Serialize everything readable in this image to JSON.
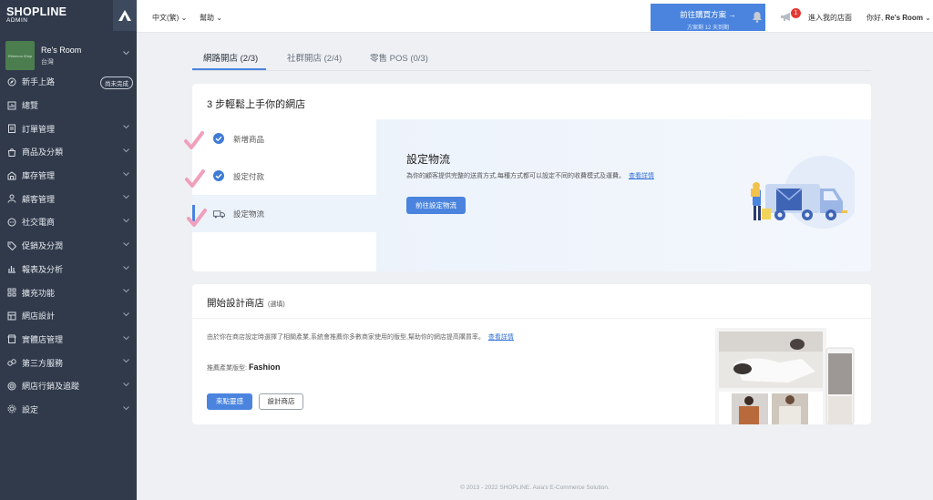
{
  "brand": {
    "logo": "SHOPLINE",
    "sub": "ADMIN"
  },
  "store": {
    "name": "Re's Room",
    "region": "台灣",
    "thumb_text": "Rebecca Shop"
  },
  "nav": {
    "items": [
      {
        "label": "新手上路",
        "icon": "compass-icon",
        "badge": "尚未完成"
      },
      {
        "label": "總覽",
        "icon": "dashboard-icon"
      },
      {
        "label": "訂單管理",
        "icon": "clipboard-icon",
        "chevron": true
      },
      {
        "label": "商品及分類",
        "icon": "bag-icon",
        "chevron": true
      },
      {
        "label": "庫存管理",
        "icon": "warehouse-icon",
        "chevron": true
      },
      {
        "label": "顧客管理",
        "icon": "person-icon",
        "chevron": true
      },
      {
        "label": "社交電商",
        "icon": "chat-icon",
        "chevron": true
      },
      {
        "label": "促銷及分潤",
        "icon": "tag-icon",
        "chevron": true
      },
      {
        "label": "報表及分析",
        "icon": "chart-icon",
        "chevron": true
      },
      {
        "label": "擴充功能",
        "icon": "grid-icon",
        "chevron": true
      },
      {
        "label": "網店設計",
        "icon": "design-icon",
        "chevron": true
      },
      {
        "label": "實體店管理",
        "icon": "store-icon",
        "chevron": true
      },
      {
        "label": "第三方服務",
        "icon": "link-icon",
        "chevron": true
      },
      {
        "label": "網店行銷及追蹤",
        "icon": "target-icon",
        "chevron": true
      },
      {
        "label": "設定",
        "icon": "gear-icon",
        "chevron": true
      }
    ]
  },
  "topbar": {
    "language": "中文(繁)",
    "help": "幫助",
    "buy_title": "前往購買方案 →",
    "buy_sub": "方案剩 12 天到期",
    "notification_count": "1",
    "enter_store": "進入我的店面",
    "greeting": "你好,",
    "user": "Re's Room"
  },
  "tabs": [
    {
      "label": "網路開店 (2/3)",
      "active": true
    },
    {
      "label": "社群開店 (2/4)",
      "active": false
    },
    {
      "label": "零售 POS (0/3)",
      "active": false
    }
  ],
  "setup": {
    "title": "3 步輕鬆上手你的網店",
    "steps": [
      {
        "label": "新增商品",
        "done": true
      },
      {
        "label": "設定付款",
        "done": true
      },
      {
        "label": "設定物流",
        "done": false
      }
    ],
    "detail_title": "設定物流",
    "detail_desc": "為你的顧客提供完整的送貨方式,每種方式都可以設定不同的收費模式及運費。",
    "detail_link": "查看詳情",
    "detail_button": "前往設定物流"
  },
  "design": {
    "title": "開始設計商店",
    "optional": "(選填)",
    "desc": "由於你在商店設定時選擇了相關產業,系統會推薦你多數商家使用的版型,幫助你的網店提高購買率。",
    "link": "查看詳情",
    "type_label": "推薦產業版型:",
    "type_value": "Fashion",
    "primary_button": "來點靈感",
    "secondary_button": "設計商店"
  },
  "footer": "© 2013 - 2022 SHOPLINE. Asia's E-Commerce Solution.",
  "colors": {
    "sidebar": "#303a4b",
    "accent": "#4a84de",
    "pink_check": "#f0a0bb"
  }
}
